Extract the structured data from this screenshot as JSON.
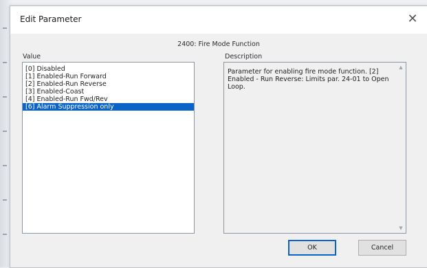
{
  "dialog": {
    "title": "Edit Parameter",
    "close_glyph": "✕"
  },
  "parameter": {
    "header": "2400: Fire Mode Function"
  },
  "value_panel": {
    "label": "Value",
    "items": [
      {
        "label": "[0] Disabled",
        "selected": false
      },
      {
        "label": "[1] Enabled-Run Forward",
        "selected": false
      },
      {
        "label": "[2] Enabled-Run Reverse",
        "selected": false
      },
      {
        "label": "[3] Enabled-Coast",
        "selected": false
      },
      {
        "label": "[4] Enabled-Run Fwd/Rev",
        "selected": false
      },
      {
        "label": "[6] Alarm Suppression only",
        "selected": true
      }
    ]
  },
  "description_panel": {
    "label": "Description",
    "text": "Parameter for enabling fire mode function. [2] Enabled - Run Reverse: Limits par. 24-01 to Open Loop."
  },
  "buttons": {
    "ok_label": "OK",
    "cancel_label": "Cancel"
  },
  "colors": {
    "selection": "#0a64c8",
    "dialog_bg": "#f0f0f0"
  }
}
